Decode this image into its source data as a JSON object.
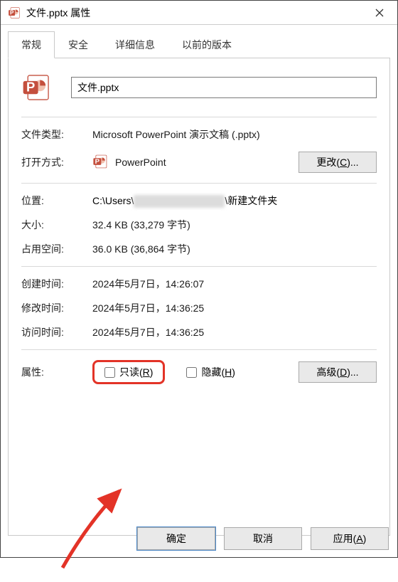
{
  "title": "文件.pptx 属性",
  "tabs": {
    "general": "常规",
    "security": "安全",
    "details": "详细信息",
    "prev": "以前的版本"
  },
  "filename": "文件.pptx",
  "ft_label": "文件类型:",
  "ft_val": "Microsoft PowerPoint 演示文稿 (.pptx)",
  "ow_label": "打开方式:",
  "ow_app": "PowerPoint",
  "change_btn": "更改(C)...",
  "loc_label": "位置:",
  "loc_pre": "C:\\Users\\",
  "loc_post": "\\新建文件夹",
  "size_label": "大小:",
  "size_val": "32.4 KB (33,279 字节)",
  "disk_label": "占用空间:",
  "disk_val": "36.0 KB (36,864 字节)",
  "ct_label": "创建时间:",
  "ct_val": "2024年5月7日，14:26:07",
  "mt_label": "修改时间:",
  "mt_val": "2024年5月7日，14:36:25",
  "at_label": "访问时间:",
  "at_val": "2024年5月7日，14:36:25",
  "attr_label": "属性:",
  "ro_label": "只读(R)",
  "hidden_label": "隐藏(H)",
  "adv_btn": "高级(D)...",
  "ok": "确定",
  "cancel": "取消",
  "apply": "应用(A)"
}
